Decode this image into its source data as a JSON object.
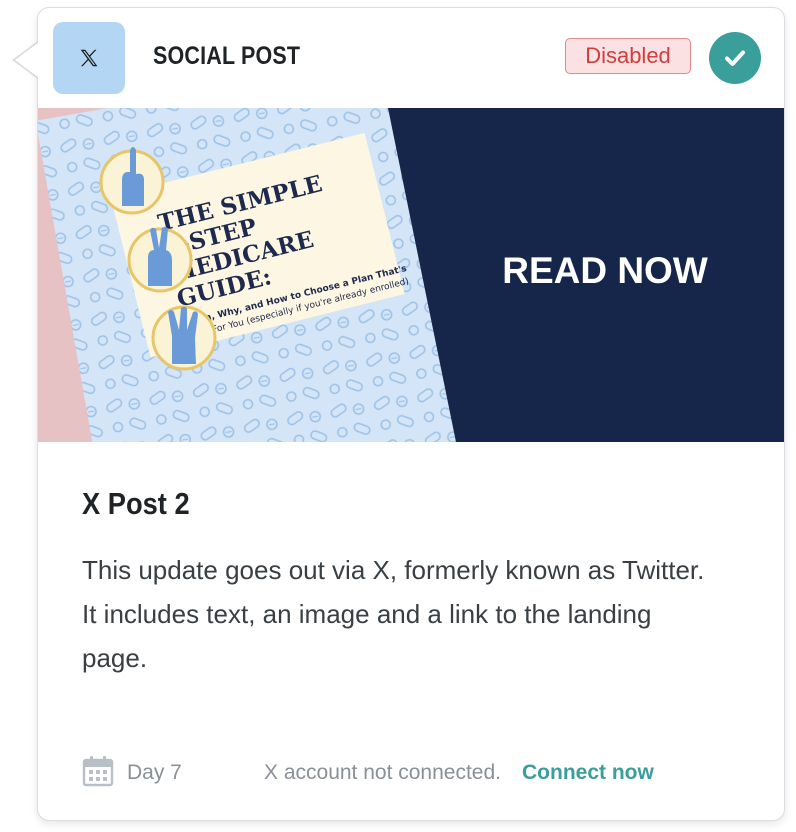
{
  "header": {
    "icon": "x-logo-icon",
    "title": "SOCIAL POST",
    "status": "Disabled",
    "check_icon": "checkmark-icon",
    "colors": {
      "badge_bg": "#b3d6f5",
      "status_text": "#d23d3d",
      "status_bg": "#fbe1e1",
      "check_bg": "#3a9e9a"
    }
  },
  "banner": {
    "cover_title_lines": [
      "THE SIMPLE",
      "3-STEP",
      "MEDICARE",
      "GUIDE:"
    ],
    "cover_subtitle_lines": [
      "When, Why, and How to Choose a Plan That's",
      "Right For You (especially if you're already enrolled)"
    ],
    "cta": "READ NOW",
    "colors": {
      "navy": "#15264a",
      "pink": "#e7c2c4",
      "pill_bg": "#d3e5f7",
      "cover_paper": "#fdf6e3"
    }
  },
  "post": {
    "title": "X Post 2",
    "description": "This update goes out via X, formerly known as Twitter. It includes text, an image and a link to the landing page."
  },
  "footer": {
    "calendar_icon": "calendar-icon",
    "day": "Day 7",
    "message": "X account not connected.",
    "link": "Connect now",
    "link_color": "#3a9e9a"
  }
}
